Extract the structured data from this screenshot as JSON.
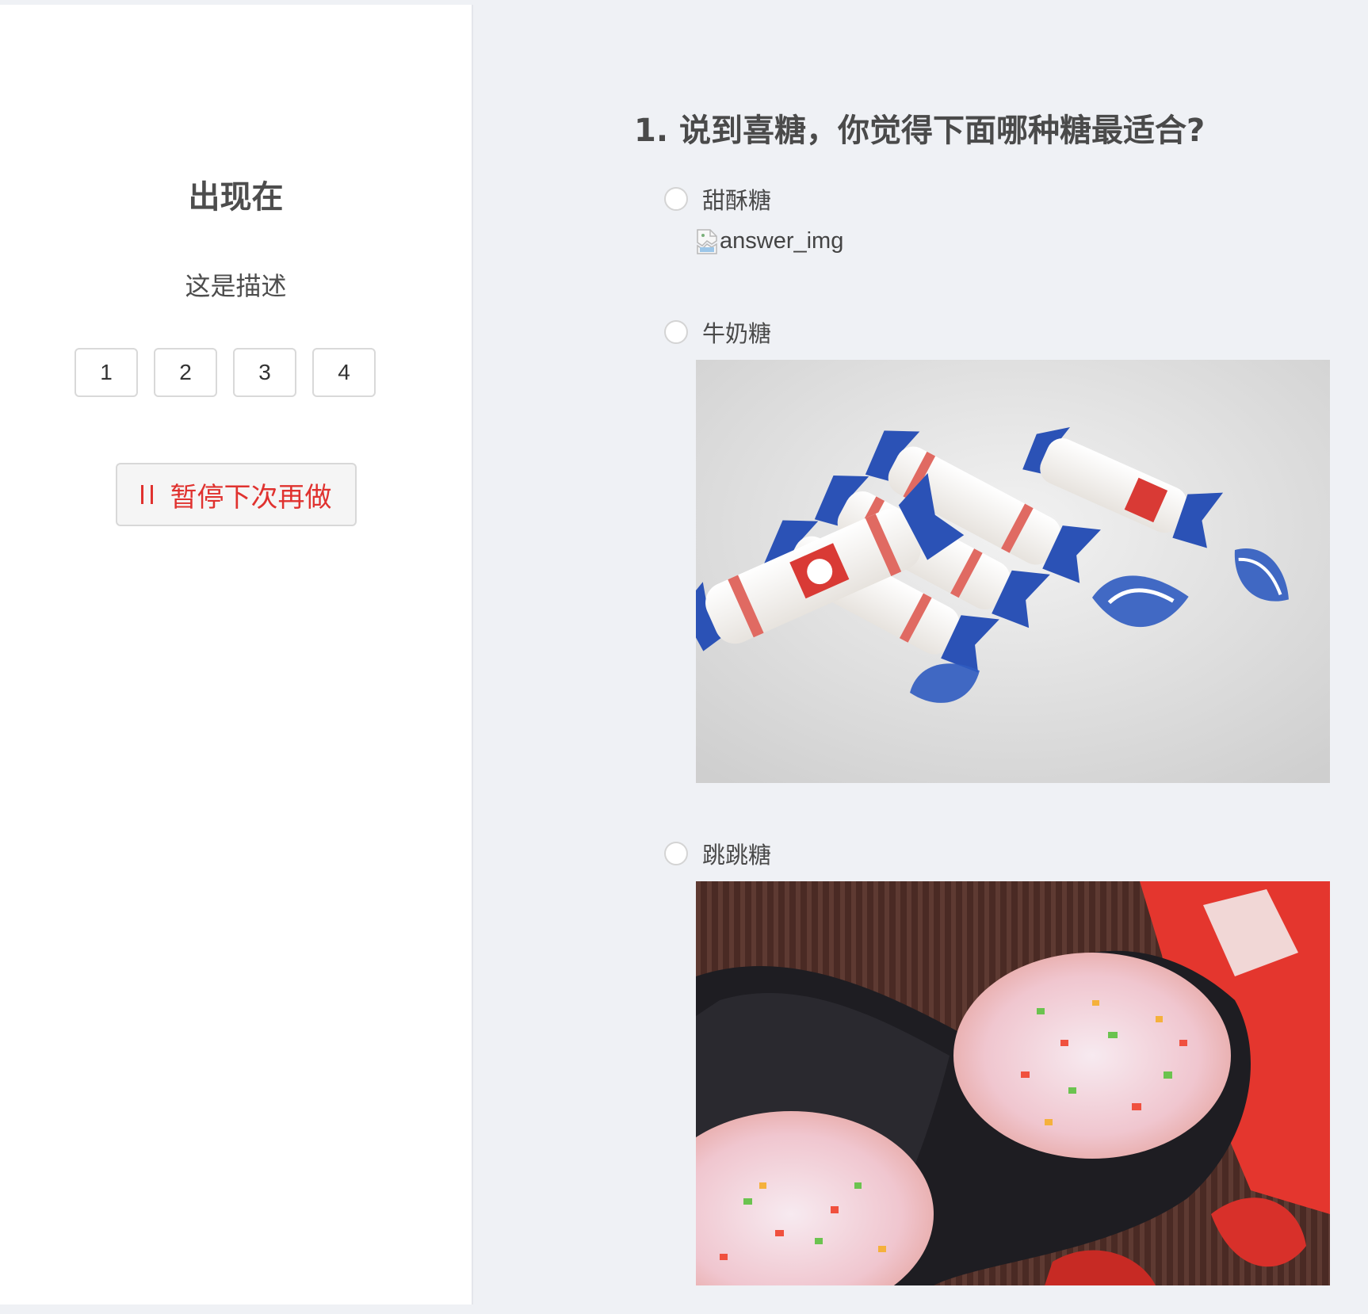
{
  "sidebar": {
    "title": "出现在",
    "description": "这是描述",
    "pages": [
      "1",
      "2",
      "3",
      "4"
    ],
    "pause_label": "暂停下次再做",
    "pause_color": "#e0322f"
  },
  "question": {
    "title": "1. 说到喜糖，你觉得下面哪种糖最适合?",
    "options": [
      {
        "label": "甜酥糖",
        "image_alt": "answer_img",
        "image": "broken-image-icon"
      },
      {
        "label": "牛奶糖",
        "image": "white-rabbit-candy-photo"
      },
      {
        "label": "跳跳糖",
        "image": "popping-candy-photo"
      }
    ]
  }
}
